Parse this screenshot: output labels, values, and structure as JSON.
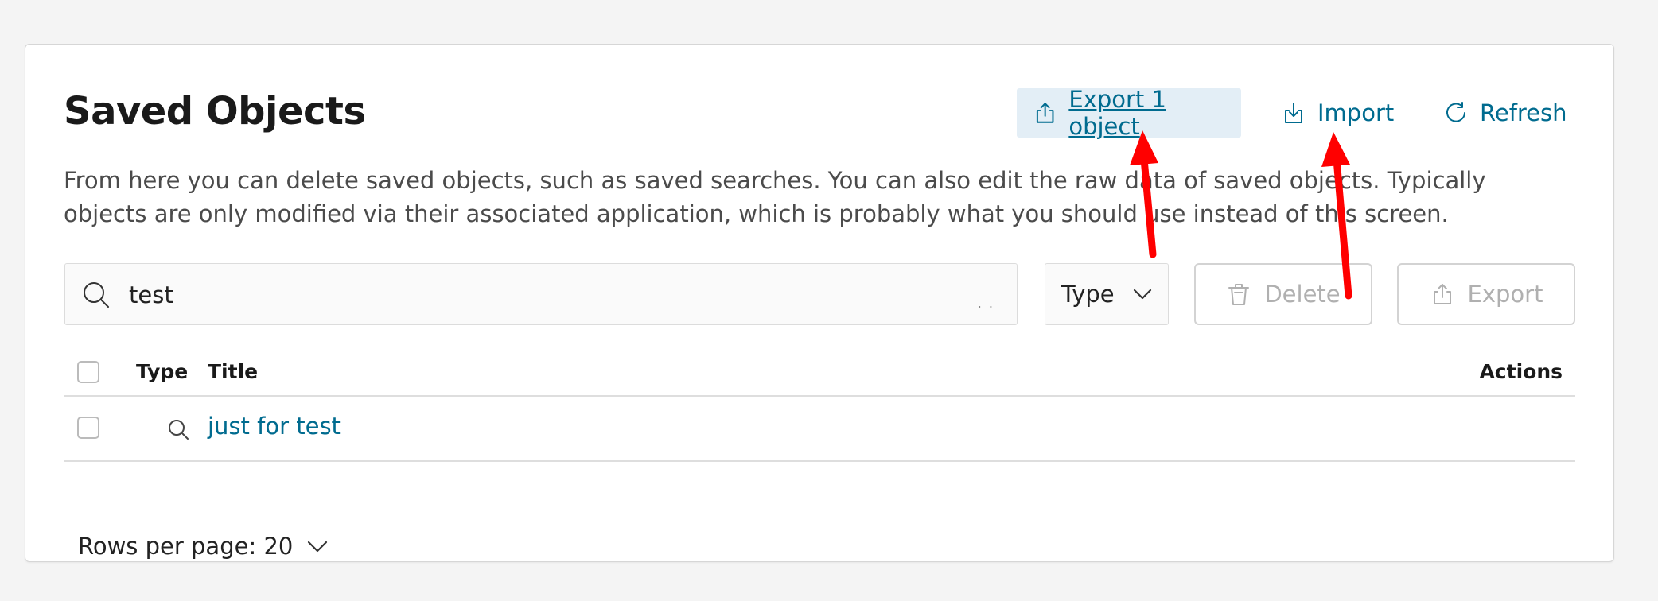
{
  "page": {
    "title": "Saved Objects",
    "description": "From here you can delete saved objects, such as saved searches. You can also edit the raw data of saved objects. Typically objects are only modified via their associated application, which is probably what you should use instead of this screen."
  },
  "header_actions": {
    "export_all_label": "Export 1 object",
    "import_label": "Import",
    "refresh_label": "Refresh"
  },
  "search": {
    "value": "test",
    "trailing": ". ."
  },
  "filters": {
    "type_label": "Type"
  },
  "bulk_actions": {
    "delete_label": "Delete",
    "export_label": "Export"
  },
  "table": {
    "columns": [
      "Type",
      "Title",
      "Actions"
    ],
    "rows": [
      {
        "type_icon": "search-icon",
        "title": "just for test"
      }
    ]
  },
  "pagination": {
    "rows_per_page_label": "Rows per page: 20"
  },
  "colors": {
    "link": "#006b8f",
    "highlight": "#e3eef6",
    "annotation_arrow": "#ff0000",
    "disabled": "#b0b0b0"
  }
}
